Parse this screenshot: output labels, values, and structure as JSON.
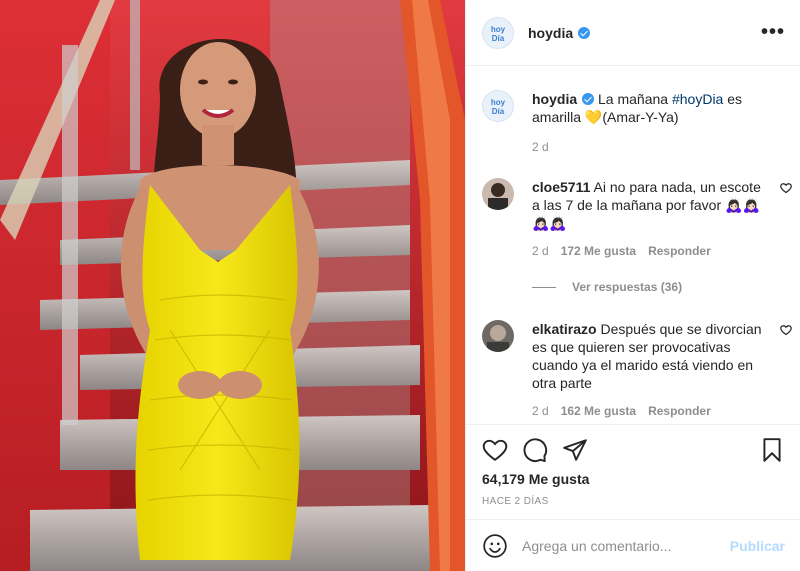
{
  "header": {
    "username": "hoydia",
    "more_label": "•••"
  },
  "logo_text": "hoyDía",
  "caption": {
    "username": "hoydia",
    "text_before": "La mañana ",
    "hashtag": "#hoyDia",
    "text_after": " es amarilla 💛(Amar-Y-Ya)",
    "time": "2 d"
  },
  "comments": [
    {
      "username": "cloe5711",
      "text": "Ai no para nada, un escote a las 7 de la mañana por favor 🙇🏻‍♀️🙇🏻‍♀️🙇🏻‍♀️🙇🏻‍♀️",
      "time": "2 d",
      "likes": "172 Me gusta",
      "reply": "Responder"
    },
    {
      "username": "elkatirazo",
      "text": "Después que se divorcian es que quieren ser provocativas cuando ya el marido está viendo en otra parte",
      "time": "2 d",
      "likes": "162 Me gusta",
      "reply": "Responder"
    }
  ],
  "view_replies": "Ver respuestas (36)",
  "post": {
    "likes": "64,179 Me gusta",
    "ago": "HACE 2 DÍAS"
  },
  "comment_box": {
    "placeholder": "Agrega un comentario...",
    "publish": "Publicar"
  },
  "colors": {
    "verified": "#3897f0",
    "link": "#00376b",
    "muted": "#8e8e8e",
    "publish_disabled": "#b3dbff",
    "dress": "#f2e000"
  }
}
